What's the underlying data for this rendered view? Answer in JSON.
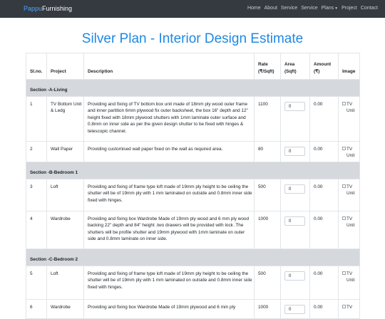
{
  "navbar": {
    "brand_part1": "Pappu",
    "brand_part2": "Furnishing",
    "links": [
      "Home",
      "About",
      "Service",
      "Service",
      "Plans",
      "Project",
      "Contact"
    ]
  },
  "page_title": "Silver Plan - Interior Design Estimate",
  "table": {
    "headers": {
      "slno": "Sl.no.",
      "project": "Project",
      "description": "Description",
      "rate_l1": "Rate",
      "rate_l2": "(₹/Sqft)",
      "area_l1": "Area",
      "area_l2": "(Sqft)",
      "amount_l1": "Amount",
      "amount_l2": "(₹)",
      "image": "Image"
    },
    "sections": [
      {
        "title": "Section -A-Living"
      },
      {
        "title": "Section -B-Bedroom 1"
      },
      {
        "title": "Section -C-Bedroom 2"
      }
    ],
    "rows": [
      {
        "slno": "1",
        "project": "TV Bottom Unit & Ledg",
        "description": "Providing and fixing of TV bottom box unit made of 18mm ply wood outer frame and inner partition 6mm plywood fix outer backsheet, the box 16\" depth and 12\" height fixed with 18mm plywood shutters with 1mm laminate outer surface and 0.8mm on inner side as per the given design shutter to be fixed with hinges & telescopic channel.",
        "rate": "1100",
        "area": "0",
        "amount": "0.00",
        "image_alt": "TV Unit"
      },
      {
        "slno": "2",
        "project": "Wall Paper",
        "description": "Providing customised wall paper fixed on the wall as required area.",
        "rate": "80",
        "area": "0",
        "amount": "0.00",
        "image_alt": "TV Unit"
      },
      {
        "slno": "3",
        "project": "Loft",
        "description": "Providing and fixing of frame type loft made of 19mm ply height to be ceiling the shutter will be of 19mm ply with 1 mm laminated on outside and 0.8mm inner side fixed with hinges.",
        "rate": "500",
        "area": "0",
        "amount": "0.00",
        "image_alt": "TV Unit"
      },
      {
        "slno": "4",
        "project": "Wardrobe",
        "description": "Providing and fixing box Wardrobe Made of 19mm ply wood and 6 mm ply wood backing 22\" depth and 84\" height .two drawers will be provided with lock .The shutters will be profile shutter and 19mm plywood with 1mm laminate on outer side and 0.8mm laminate on inner side.",
        "rate": "1000",
        "area": "0",
        "amount": "0.00",
        "image_alt": "TV Unit"
      },
      {
        "slno": "5",
        "project": "Loft",
        "description": "Providing and fixing of frame type loft made of 19mm ply height to be ceiling the shutter will be of 19mm ply with 1 mm laminated on outside and 0.8mm inner side fixed with hinges.",
        "rate": "500",
        "area": "0",
        "amount": "0.00",
        "image_alt": "TV Unit"
      },
      {
        "slno": "6",
        "project": "Wardrobe",
        "description": "Providing and fixing box Wardrobe Made of 19mm plywood and 6 mm ply",
        "rate": "1000",
        "area": "0",
        "amount": "0.00",
        "image_alt": "TV"
      }
    ]
  },
  "colors": {
    "navbar_bg": "#343a40",
    "brand_accent": "#4da3ff",
    "title": "#1e88e5",
    "section_bg": "#d5d8dc"
  }
}
